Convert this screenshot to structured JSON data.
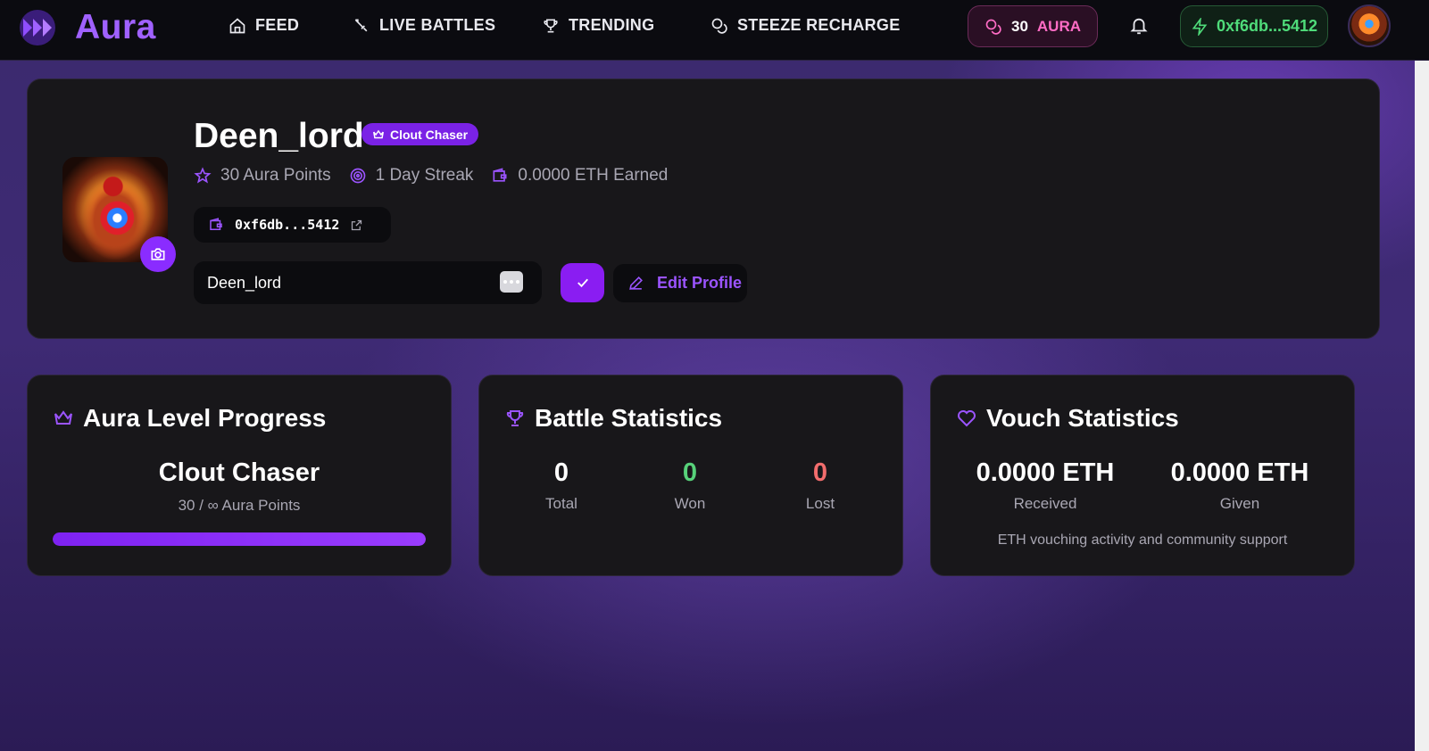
{
  "brand": {
    "name": "Aura",
    "logo_icon": "aura-logo-icon"
  },
  "nav": {
    "items": [
      {
        "label": "FEED",
        "icon": "home-icon"
      },
      {
        "label": "LIVE BATTLES",
        "icon": "sword-icon"
      },
      {
        "label": "TRENDING",
        "icon": "trophy-icon"
      },
      {
        "label": "STEEZE RECHARGE",
        "icon": "coins-icon"
      }
    ],
    "aura_pill": {
      "value": "30",
      "label": "AURA"
    },
    "wallet": "0xf6db...5412"
  },
  "profile": {
    "username": "Deen_lord",
    "badge": "Clout Chaser",
    "stats": {
      "aura_points": "30 Aura Points",
      "streak": "1 Day Streak",
      "eth_earned": "0.0000 ETH Earned"
    },
    "address": "0xf6db...5412",
    "name_input_value": "Deen_lord",
    "edit_label": "Edit Profile"
  },
  "aura_level": {
    "title": "Aura Level Progress",
    "level_name": "Clout Chaser",
    "points_text": "30 / ∞ Aura Points",
    "progress_fraction": 1.0
  },
  "battle_stats": {
    "title": "Battle Statistics",
    "items": [
      {
        "value": "0",
        "label": "Total",
        "color": "#ffffff"
      },
      {
        "value": "0",
        "label": "Won",
        "color": "#57d27a"
      },
      {
        "value": "0",
        "label": "Lost",
        "color": "#f26d6d"
      }
    ]
  },
  "vouch_stats": {
    "title": "Vouch Statistics",
    "received": {
      "value": "0.0000 ETH",
      "label": "Received"
    },
    "given": {
      "value": "0.0000 ETH",
      "label": "Given"
    },
    "note": "ETH vouching activity and community support"
  },
  "colors": {
    "accent": "#8a2cff",
    "pink": "#ff6cc5",
    "green": "#4fdc7a"
  }
}
